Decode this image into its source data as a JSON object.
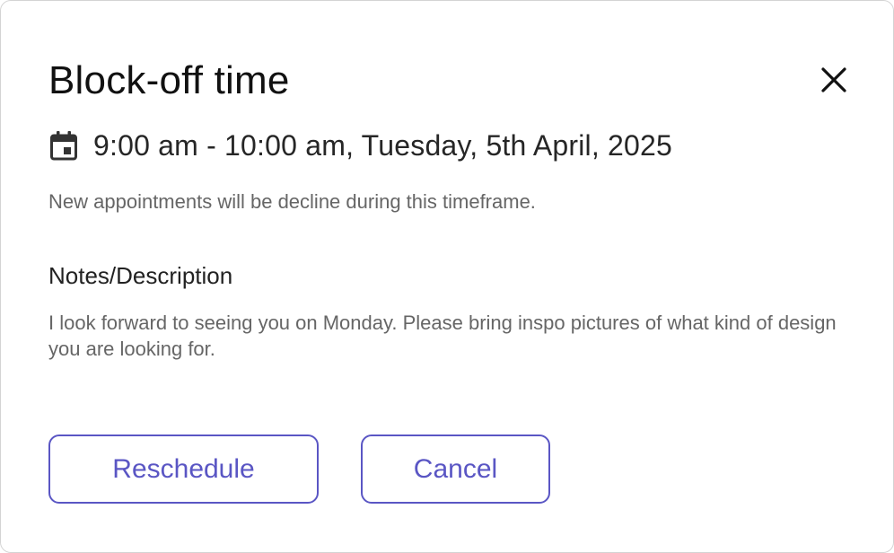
{
  "dialog": {
    "title": "Block-off time",
    "close_icon": "close-icon",
    "datetime": {
      "icon": "calendar-icon",
      "text": "9:00 am - 10:00 am, Tuesday, 5th April, 2025"
    },
    "notice": "New appointments will be decline during this timeframe.",
    "notes": {
      "label": "Notes/Description",
      "text": "I look forward to seeing you on Monday. Please bring inspo pictures of what kind of design you are looking for."
    },
    "buttons": {
      "reschedule_label": "Reschedule",
      "cancel_label": "Cancel"
    }
  },
  "colors": {
    "accent": "#5a56c4",
    "title": "#111111",
    "body_text": "#666666",
    "border": "#d4d4d4"
  }
}
